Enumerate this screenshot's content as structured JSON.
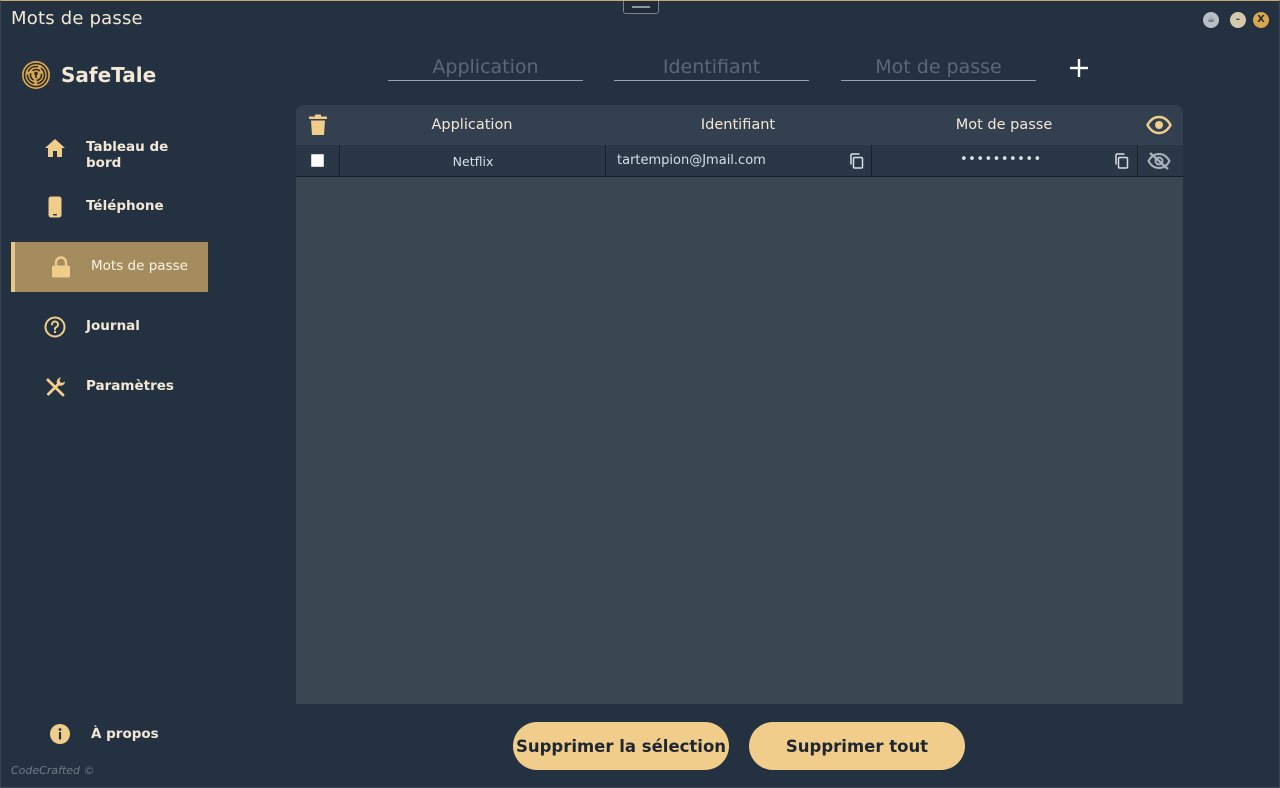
{
  "window": {
    "title": "Mots de passe",
    "theme_btn": "☕",
    "minimize_btn": "-",
    "close_btn": "X"
  },
  "brand": {
    "name": "SafeTale"
  },
  "sidebar": {
    "items": [
      {
        "label": "Tableau de bord",
        "icon": "home-icon"
      },
      {
        "label": "Téléphone",
        "icon": "phone-icon"
      },
      {
        "label": "Mots de passe",
        "icon": "lock-icon",
        "active": true
      },
      {
        "label": "Journal",
        "icon": "question-icon"
      },
      {
        "label": "Paramètres",
        "icon": "tools-icon"
      }
    ],
    "about": {
      "label": "À propos",
      "icon": "info-icon"
    },
    "credit": "CodeCrafted ©"
  },
  "form": {
    "application_placeholder": "Application",
    "identifiant_placeholder": "Identifiant",
    "password_placeholder": "Mot de passe",
    "application_value": "",
    "identifiant_value": "",
    "password_value": ""
  },
  "table": {
    "headers": [
      "Application",
      "Identifiant",
      "Mot de passe"
    ],
    "rows": [
      {
        "application": "Netflix",
        "identifiant": "tartempion@Jmail.com",
        "password": "••••••••••",
        "selected": false
      }
    ]
  },
  "actions": {
    "delete_selection": "Supprimer la sélection",
    "delete_all": "Supprimer tout"
  },
  "colors": {
    "background": "#233140",
    "panel": "#3a4652",
    "accent": "#f1cd8b",
    "active_nav": "#a48c5f",
    "text": "#f2e8d5"
  }
}
